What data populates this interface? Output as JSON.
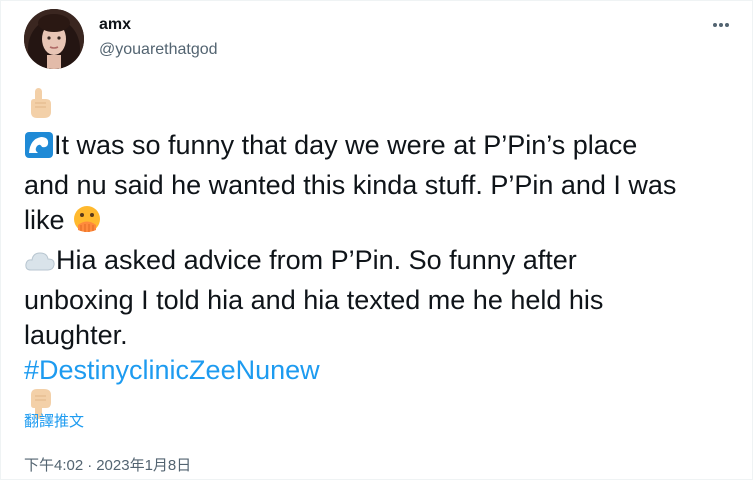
{
  "tweet": {
    "display_name": "amx",
    "handle": "@youarethatgod",
    "body": {
      "line1_text": "It was so funny that day we were at P’Pin’s place",
      "line2_text": "and nu said he wanted this kinda stuff. P’Pin and I was",
      "line3_text": "like",
      "line4_text": "Hia asked advice from P’Pin. So funny after",
      "line5_text": "unboxing I told hia and hia texted me he held his",
      "line6_text": "laughter.",
      "hashtag": "#DestinyclinicZeeNunew"
    },
    "icons": {
      "top": "pointing-up-emoji",
      "wave": "wave-emoji",
      "face": "face-hand-over-mouth-emoji",
      "cloud": "cloud-emoji",
      "bottom": "pointing-down-emoji",
      "more": "more-options-icon"
    },
    "translate_label": "翻譯推文",
    "time": "下午4:02",
    "separator": "·",
    "date": "2023年1月8日",
    "colors": {
      "link": "#1d9bf0",
      "muted": "#536471",
      "text": "#0f1419"
    }
  }
}
